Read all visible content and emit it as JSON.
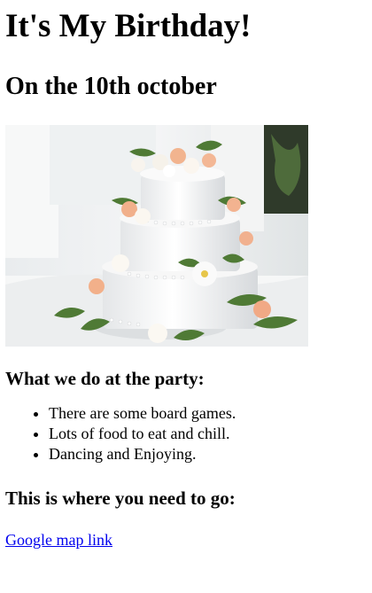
{
  "page": {
    "title": "It's My Birthday!",
    "subtitle": "On the 10th october",
    "image": {
      "icon": "birthday-cake-photo"
    },
    "party_heading": "What we do at the party:",
    "activities": [
      "There are some board games.",
      "Lots of food to eat and chill.",
      "Dancing and Enjoying."
    ],
    "location_heading": "This is where you need to go:",
    "map_link_text": "Google map link"
  },
  "colors": {
    "link": "#0000ee",
    "text": "#000000",
    "background": "#ffffff"
  }
}
